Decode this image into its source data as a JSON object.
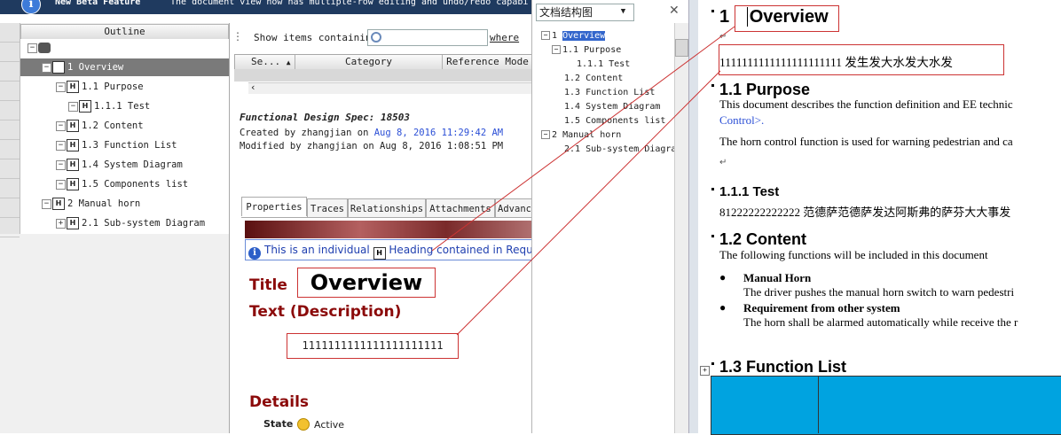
{
  "banner": {
    "title": "New Beta Feature",
    "message": "The document view now has multiple-row editing and undo/redo capabi"
  },
  "outline": {
    "header": "Outline",
    "items": [
      {
        "label": "1 Overview"
      },
      {
        "label": "1.1 Purpose"
      },
      {
        "label": "1.1.1 Test"
      },
      {
        "label": "1.2 Content"
      },
      {
        "label": "1.3 Function List"
      },
      {
        "label": "1.4 System Diagram"
      },
      {
        "label": "1.5 Components list"
      },
      {
        "label": "2 Manual horn"
      },
      {
        "label": "2.1 Sub-system Diagram"
      }
    ]
  },
  "search": {
    "label": "Show items containing",
    "where": "where"
  },
  "grid": {
    "columns": [
      "Se...",
      "Category",
      "Reference Mode"
    ]
  },
  "document": {
    "title": "Functional Design Spec: 18503",
    "created_prefix": "Created by zhangjian on",
    "created_date": "Aug 8, 2016 11:29:42 AM",
    "modified": "Modified by zhangjian on Aug 8, 2016 1:08:51 PM"
  },
  "tabs": [
    "Properties",
    "Traces",
    "Relationships",
    "Attachments",
    "Advanc"
  ],
  "note": {
    "text1": "This is an individual",
    "text2": "Heading contained in Requireme"
  },
  "properties": {
    "title_label": "Title",
    "title_value": "Overview",
    "desc_label": "Text (Description)",
    "desc_value": "1111111111111111111111",
    "details_label": "Details",
    "state_label": "State",
    "state_value": "Active"
  },
  "nav_pane": {
    "title": "文档结构图",
    "items": [
      {
        "num": "1",
        "label": "Overview"
      },
      {
        "num": "1.1",
        "label": "Purpose"
      },
      {
        "num": "1.1.1",
        "label": "Test"
      },
      {
        "num": "1.2",
        "label": "Content"
      },
      {
        "num": "1.3",
        "label": "Function List"
      },
      {
        "num": "1.4",
        "label": "System Diagram"
      },
      {
        "num": "1.5",
        "label": "Components list"
      },
      {
        "num": "2",
        "label": "Manual horn"
      },
      {
        "num": "2.1",
        "label": "Sub-system Diagra"
      }
    ]
  },
  "word": {
    "h1_num": "1",
    "h1_text": "Overview",
    "body1": "1111111111111111111111 发生发大水发大水发",
    "h11": "1.1  Purpose",
    "p11a": "This document describes the function definition and EE technic",
    "p11b": "Control>.",
    "p11c": "The horn control function is used for warning pedestrian and ca",
    "h111": "1.1.1   Test",
    "p111": "81222222222222 范德萨范德萨发达阿斯弗的萨芬大大事发",
    "h12": "1.2  Content",
    "p12": "The following functions will be included in this document",
    "b1_title": "Manual Horn",
    "b1_text": "The driver pushes the manual horn switch to warn pedestri",
    "b2_title": "Requirement from other system",
    "b2_text": "The horn shall be alarmed automatically while receive the r",
    "h13": "1.3  Function List"
  },
  "colors": {
    "heading_red": "#8b0a0a",
    "callout_red": "#cc3333",
    "link_blue": "#2b4fd6",
    "table_blue": "#00a3e0"
  }
}
